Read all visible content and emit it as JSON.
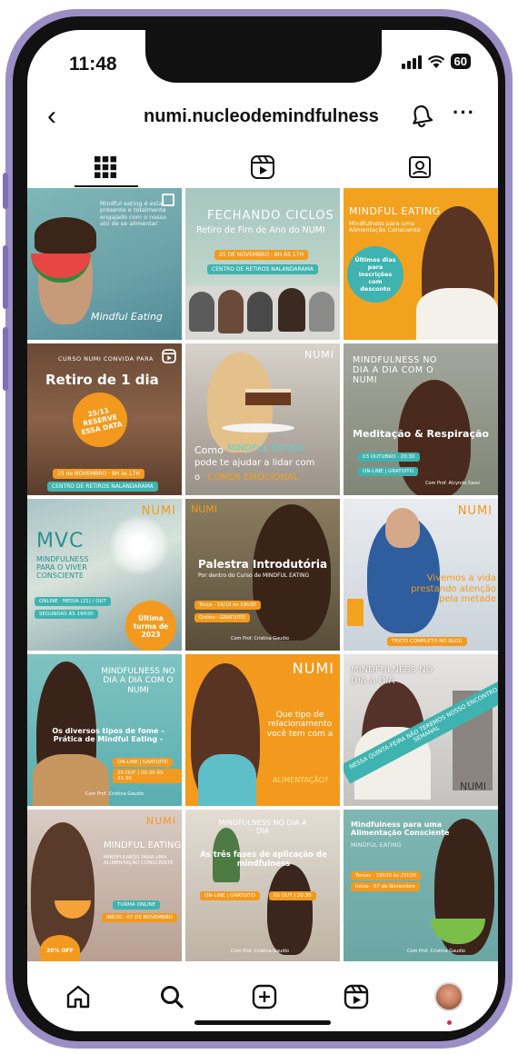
{
  "status_bar": {
    "time": "11:48",
    "battery": "60"
  },
  "header": {
    "username": "numi.nucleodemindfulness"
  },
  "tabs": [
    "posts-grid",
    "reels",
    "tagged"
  ],
  "posts": [
    {
      "title": "Mindful Eating",
      "body": "Mindful eating é estar presente e totalmente engajado com o nosso ato de se alimentar.",
      "footer": ""
    },
    {
      "title": "FECHANDO CICLOS",
      "subtitle": "Retiro de Fim de Ano do NUMI",
      "date": "25 DE NOVEMBRO · 8H ÀS 17H",
      "place": "CENTRO DE RETIROS NALANDARAMA"
    },
    {
      "title": "MINDFUL EATING",
      "subtitle": "Mindfulness para uma Alimentação Consciente",
      "badge": "Últimos dias para inscrições com desconto"
    },
    {
      "kicker": "CURSO NUMI CONVIDA PARA",
      "title": "Retiro de 1 dia",
      "badge": "25/11 RESERVE ESSA DATA",
      "date": "25 de NOVEMBRO · 8H às 17H",
      "place": "CENTRO DE RETIROS NALANDARAMA"
    },
    {
      "line1": "Como",
      "highlight": "MINDFUL EATING",
      "line2": "pode te ajudar a lidar com",
      "line3": "o",
      "highlight2": "COMER EMOCIONAL"
    },
    {
      "title": "MINDFULNESS NO DIA A DIA COM O NUMI",
      "subtitle": "Meditação & Respiração",
      "date": "03 OUTUBRO · 20:30",
      "pill": "ON-LINE | GRATUITO",
      "footer": "Com Prof. Alcyndo Sassi"
    },
    {
      "title": "MVC",
      "subtitle": "MINDFULNESS PARA O VIVER CONSCIENTE",
      "pill": "ONLINE · MEDIA (21) / OUT",
      "pill2": "SEGUNDAS ÀS 19H30",
      "badge": "Última turma de 2023"
    },
    {
      "kicker": "NUMI",
      "title": "Palestra Introdutória",
      "subtitle": "Por dentro do Curso de MINDFUL EATING",
      "pill": "Terça · 24/10 às 19h30",
      "pill2": "Online · GRATUITO",
      "footer": "Com Prof. Cristina Gaudio"
    },
    {
      "brand": "NUMI",
      "title": "Vivemos a vida prestando atenção pela metade",
      "pill": "TEXTO COMPLETO NO BLOG"
    },
    {
      "title": "MINDFULNESS NO DIA A DIA COM O NUMI",
      "subtitle": "Os diversos tipos de fome - Prática de Mindful Eating -",
      "pill": "ON-LINE | GRATUITO",
      "date": "29 OUT | 20:30 ÀS 21:30",
      "footer": "Com Prof. Cristina Gaudio"
    },
    {
      "brand": "NUMI",
      "title": "Que tipo de relacionamento você tem com a",
      "highlight": "ALIMENTAÇÃO?"
    },
    {
      "title": "MINDFULNESS NO DIA A DIA",
      "banner": "NESSA QUINTA-FEIRA NÃO TEREMOS NOSSO ENCONTRO SEMANAL",
      "brand": "NUMI"
    },
    {
      "brand": "NUMI",
      "title": "MINDFUL EATING",
      "subtitle": "MINDFULNESS PARA UMA ALIMENTAÇÃO CONSCIENTE",
      "pill": "TURMA ONLINE",
      "date": "INÍCIO · 07 DE NOVEMBRO",
      "badge": "20% OFF"
    },
    {
      "title": "MINDFULNESS NO DIA A DIA",
      "subtitle": "As três fases de aplicação de mindfulness",
      "pill": "ON-LINE | GRATUITO",
      "date": "05 OUT | 20:30",
      "footer": "Com Prof. Cristina Gaudio"
    },
    {
      "title": "Mindfulness para uma Alimentação Consciente",
      "subtitle": "MINDFUL EATING",
      "pill": "Terças · 19h30 às 21h30",
      "date": "Início · 07 de Novembro",
      "footer": "Com Prof. Cristina Gaudio"
    }
  ],
  "colors": {
    "accent_orange": "#f39a1e",
    "teal": "#3fb3b0",
    "frame": "#9a8fc4"
  }
}
